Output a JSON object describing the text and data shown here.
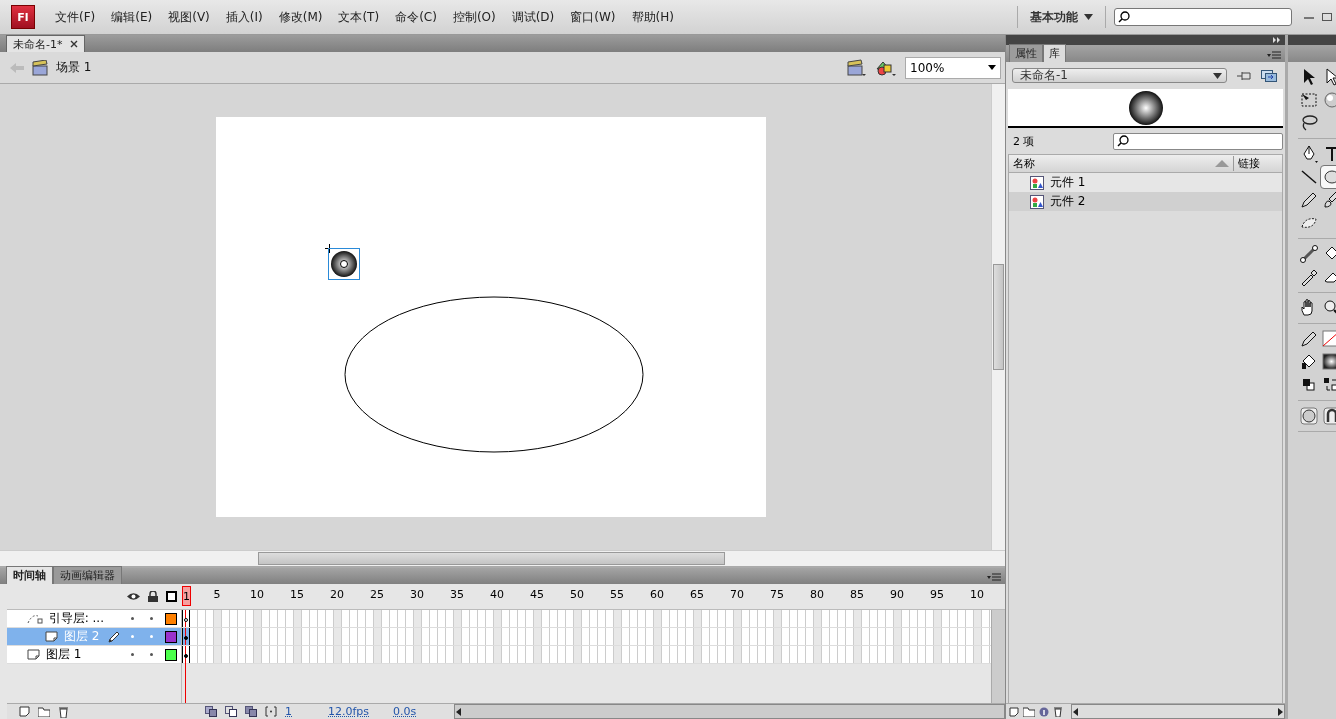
{
  "app_logo": "Fl",
  "menu": [
    "文件(F)",
    "编辑(E)",
    "视图(V)",
    "插入(I)",
    "修改(M)",
    "文本(T)",
    "命令(C)",
    "控制(O)",
    "调试(D)",
    "窗口(W)",
    "帮助(H)"
  ],
  "workspace": {
    "label": "基本功能"
  },
  "document_tabs": [
    {
      "title": "未命名-1*",
      "selected": true
    }
  ],
  "edit_bar": {
    "scene": "场景 1",
    "zoom": "100%"
  },
  "stage": {
    "instance_selected": true
  },
  "timeline": {
    "tabs": [
      {
        "label": "时间轴",
        "selected": true
      },
      {
        "label": "动画编辑器",
        "selected": false
      }
    ],
    "frame_numbers": [
      "1",
      "5",
      "10",
      "15",
      "20",
      "25",
      "30",
      "35",
      "40",
      "45",
      "50",
      "55",
      "60",
      "65",
      "70",
      "75",
      "80",
      "85",
      "90",
      "95",
      "10"
    ],
    "layers": [
      {
        "name": "引导层: ...",
        "kind": "guide",
        "selected": false,
        "editing": false,
        "color": "#ff8000",
        "keyframe_filled": false,
        "children": [
          {
            "name": "图层 2",
            "kind": "normal",
            "selected": true,
            "editing": true,
            "color": "#9933cc",
            "keyframe_filled": true
          }
        ]
      },
      {
        "name": "图层 1",
        "kind": "normal",
        "selected": false,
        "editing": false,
        "color": "#4cff4c",
        "keyframe_filled": true
      }
    ],
    "status": {
      "frame": "1",
      "fps": "12.0fps",
      "time": "0.0s"
    }
  },
  "library": {
    "tabs": [
      {
        "label": "属性",
        "selected": false
      },
      {
        "label": "库",
        "selected": true
      }
    ],
    "document": "未命名-1",
    "count": "2 项",
    "columns": [
      "名称",
      "链接"
    ],
    "items": [
      {
        "name": "元件 1",
        "selected": false
      },
      {
        "name": "元件 2",
        "selected": true
      }
    ]
  },
  "tool_groups": [
    [
      {
        "kind": "arrow",
        "selected": false
      },
      {
        "kind": "subselect",
        "selected": false
      },
      {
        "kind": "free-transform",
        "selected": false
      },
      {
        "kind": "sphere",
        "selected": false
      },
      {
        "kind": "lasso",
        "selected": false
      }
    ],
    [
      {
        "kind": "pen",
        "selected": false
      },
      {
        "kind": "text",
        "selected": false
      },
      {
        "kind": "line",
        "selected": false
      },
      {
        "kind": "oval",
        "selected": true
      },
      {
        "kind": "pencil",
        "selected": false
      },
      {
        "kind": "brush",
        "selected": false
      },
      {
        "kind": "deco",
        "selected": false
      }
    ],
    [
      {
        "kind": "bone",
        "selected": false
      },
      {
        "kind": "bucket",
        "selected": false
      },
      {
        "kind": "eyedropper",
        "selected": false
      },
      {
        "kind": "eraser",
        "selected": false
      }
    ],
    [
      {
        "kind": "hand",
        "selected": false
      },
      {
        "kind": "zoom",
        "selected": false
      }
    ],
    [
      {
        "kind": "stroke-pencil",
        "selected": false
      },
      {
        "kind": "stroke-swatch",
        "selected": false
      },
      {
        "kind": "fill-bucket",
        "selected": false
      },
      {
        "kind": "fill-swatch",
        "selected": false
      },
      {
        "kind": "black-white",
        "selected": false
      },
      {
        "kind": "swap",
        "selected": false
      }
    ],
    [
      {
        "kind": "object-drawing",
        "selected": false
      },
      {
        "kind": "snap",
        "selected": false
      }
    ]
  ]
}
